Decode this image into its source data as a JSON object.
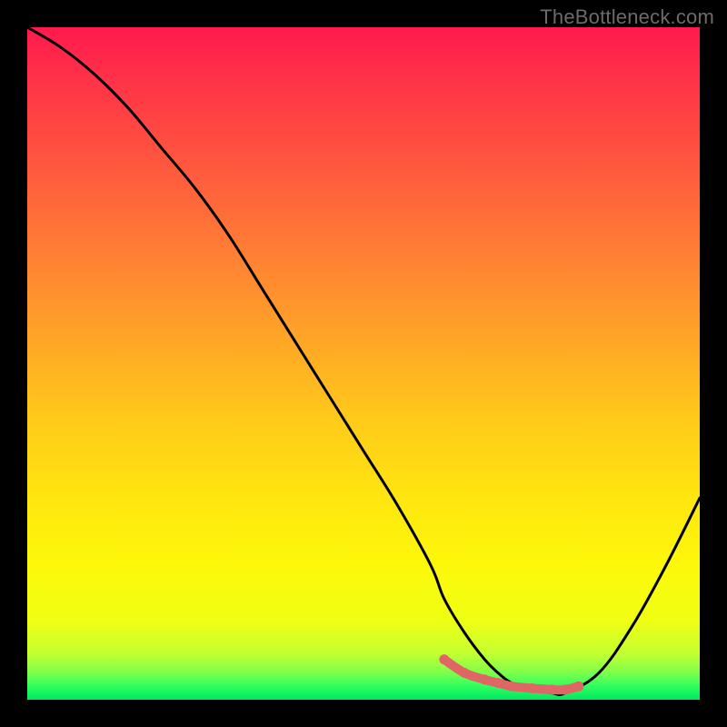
{
  "watermark": "TheBottleneck.com",
  "chart_data": {
    "type": "line",
    "title": "",
    "xlabel": "",
    "ylabel": "",
    "xlim": [
      0,
      100
    ],
    "ylim": [
      0,
      100
    ],
    "series": [
      {
        "name": "bottleneck-curve",
        "color": "#000000",
        "x": [
          0,
          5,
          10,
          15,
          20,
          25,
          30,
          35,
          40,
          45,
          50,
          55,
          60,
          62,
          65,
          68,
          70,
          72,
          75,
          78,
          80,
          85,
          90,
          95,
          100
        ],
        "y": [
          100,
          97,
          93,
          88,
          82,
          76,
          69,
          61,
          53,
          45,
          37,
          29,
          20,
          15,
          10,
          6,
          4,
          2.5,
          1.5,
          1,
          1,
          4,
          11,
          20,
          30
        ]
      },
      {
        "name": "optimal-band",
        "color": "#e86a6a",
        "x": [
          62,
          65,
          68,
          70,
          72,
          75,
          78,
          80,
          82
        ],
        "y": [
          6,
          4,
          3,
          2.5,
          2,
          1.7,
          1.5,
          1.5,
          2
        ]
      }
    ]
  }
}
